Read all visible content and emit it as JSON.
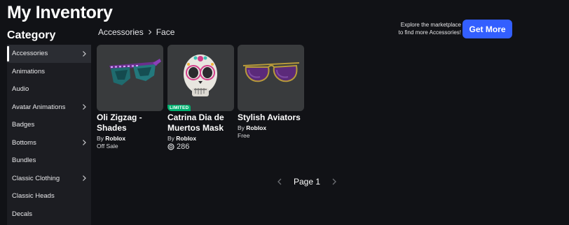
{
  "page_title": "My Inventory",
  "category_heading": "Category",
  "sidebar": {
    "items": [
      {
        "label": "Accessories",
        "active": true,
        "has_chevron": true
      },
      {
        "label": "Animations",
        "active": false,
        "has_chevron": false
      },
      {
        "label": "Audio",
        "active": false,
        "has_chevron": false
      },
      {
        "label": "Avatar Animations",
        "active": false,
        "has_chevron": true
      },
      {
        "label": "Badges",
        "active": false,
        "has_chevron": false
      },
      {
        "label": "Bottoms",
        "active": false,
        "has_chevron": true
      },
      {
        "label": "Bundles",
        "active": false,
        "has_chevron": false
      },
      {
        "label": "Classic Clothing",
        "active": false,
        "has_chevron": true
      },
      {
        "label": "Classic Heads",
        "active": false,
        "has_chevron": false
      },
      {
        "label": "Decals",
        "active": false,
        "has_chevron": false
      }
    ]
  },
  "breadcrumb": {
    "parent": "Accessories",
    "current": "Face",
    "separator_icon": "chevron-right-icon"
  },
  "promo": {
    "line1": "Explore the marketplace",
    "line2": "to find more Accessories!",
    "button_label": "Get More"
  },
  "items": [
    {
      "name": "Oli Zigzag - Shades",
      "by_prefix": "By",
      "creator": "Roblox",
      "price": "Off Sale",
      "limited": false,
      "icon": "zigzag-shades-image"
    },
    {
      "name": "Catrina Dia de Muertos Mask",
      "by_prefix": "By",
      "creator": "Roblox",
      "price": "286",
      "limited": true,
      "limited_label": "LIMITED",
      "icon": "catrina-mask-image",
      "currency_icon": "robux-icon"
    },
    {
      "name": "Stylish Aviators",
      "by_prefix": "By",
      "creator": "Roblox",
      "price": "Free",
      "limited": false,
      "icon": "aviators-image"
    }
  ],
  "pagination": {
    "label": "Page 1"
  },
  "colors": {
    "background": "#111216",
    "sidebar": "#1c1d22",
    "thumb": "#393b3d",
    "accent": "#335fff",
    "limited": "#00b06f"
  }
}
